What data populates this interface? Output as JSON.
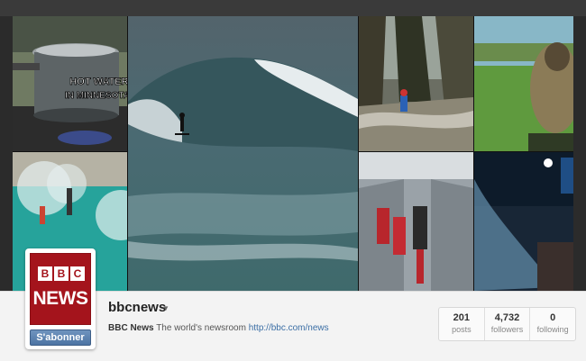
{
  "mosaic": {
    "tiles": [
      {
        "caption_line1": "HOT WATER",
        "caption_line2": "IN MINNESOTA"
      },
      {},
      {},
      {},
      {},
      {},
      {},
      {}
    ]
  },
  "profile": {
    "logo_letters": [
      "B",
      "B",
      "C"
    ],
    "logo_word": "NEWS",
    "subscribe_label": "S'abonner",
    "username": "bbcnews",
    "bio_name": "BBC News",
    "bio_text": "The world's newsroom",
    "bio_link": "http://bbc.com/news",
    "stats": [
      {
        "value": "201",
        "label": "posts"
      },
      {
        "value": "4,732",
        "label": "followers"
      },
      {
        "value": "0",
        "label": "following"
      }
    ]
  },
  "colors": {
    "brand_red": "#a4141c",
    "link_blue": "#3b6ea5",
    "button_blue": "#5a7fad"
  }
}
